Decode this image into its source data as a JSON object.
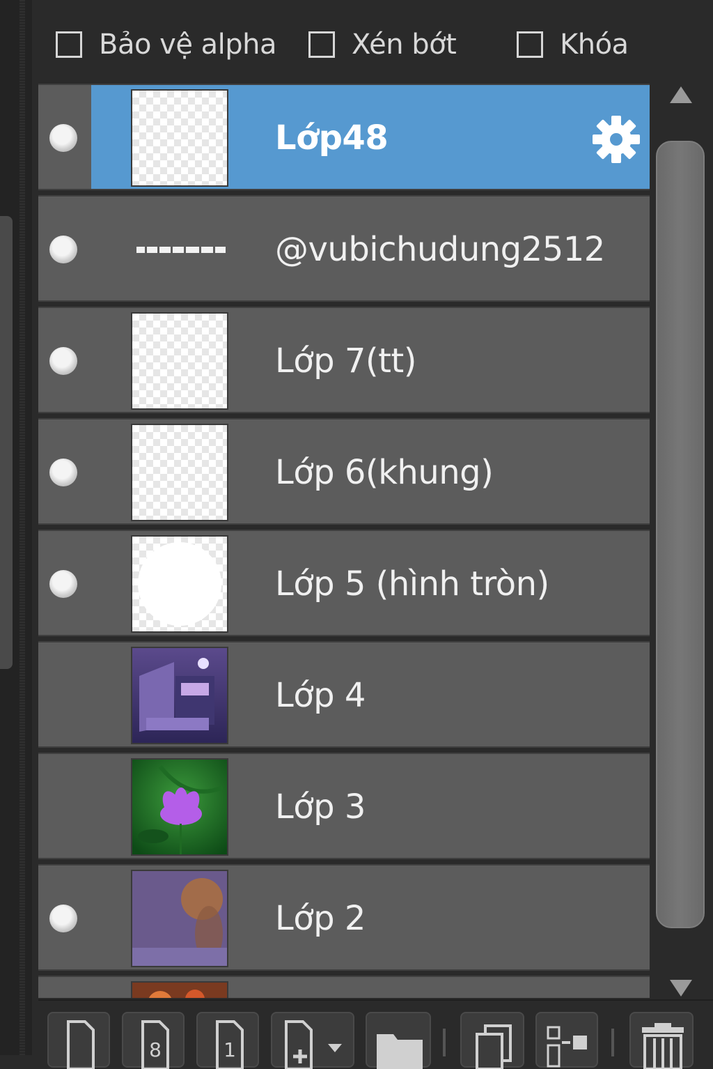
{
  "options": {
    "protect_alpha": {
      "label": "Bảo vệ alpha",
      "checked": false
    },
    "clip": {
      "label": "Xén bớt",
      "checked": false
    },
    "lock": {
      "label": "Khóa",
      "checked": false
    }
  },
  "layers": [
    {
      "name": "Lớp48",
      "visible": true,
      "selected": true,
      "thumb": "transparent",
      "settings_icon": "gear-icon"
    },
    {
      "name": "@vubichudung2512",
      "visible": true,
      "selected": false,
      "thumb": "text-strip"
    },
    {
      "name": "Lớp 7(tt)",
      "visible": true,
      "selected": false,
      "thumb": "transparent"
    },
    {
      "name": "Lớp 6(khung)",
      "visible": true,
      "selected": false,
      "thumb": "transparent"
    },
    {
      "name": "Lớp 5 (hình tròn)",
      "visible": true,
      "selected": false,
      "thumb": "white-circle"
    },
    {
      "name": "Lớp 4",
      "visible": false,
      "selected": false,
      "thumb": "purple-scene"
    },
    {
      "name": "Lớp 3",
      "visible": false,
      "selected": false,
      "thumb": "purple-flower"
    },
    {
      "name": "Lớp 2",
      "visible": true,
      "selected": false,
      "thumb": "purple-haze"
    },
    {
      "name": "",
      "visible": false,
      "selected": false,
      "thumb": "orange-partial"
    }
  ],
  "toolbar": {
    "new_layer_icon": "new-layer-icon",
    "new_8bit_layer_icon": "new-8bit-layer-icon",
    "new_1bit_layer_icon": "new-1bit-layer-icon",
    "add_layer_menu_icon": "add-layer-dropdown-icon",
    "new_folder_icon": "folder-icon",
    "duplicate_icon": "duplicate-icon",
    "merge_down_icon": "merge-icon",
    "delete_icon": "trash-icon",
    "bit_8": "8",
    "bit_1": "1"
  },
  "colors": {
    "selected_row": "#5699d0",
    "row_bg": "#5c5c5c",
    "panel_bg": "#2a2a2a"
  }
}
